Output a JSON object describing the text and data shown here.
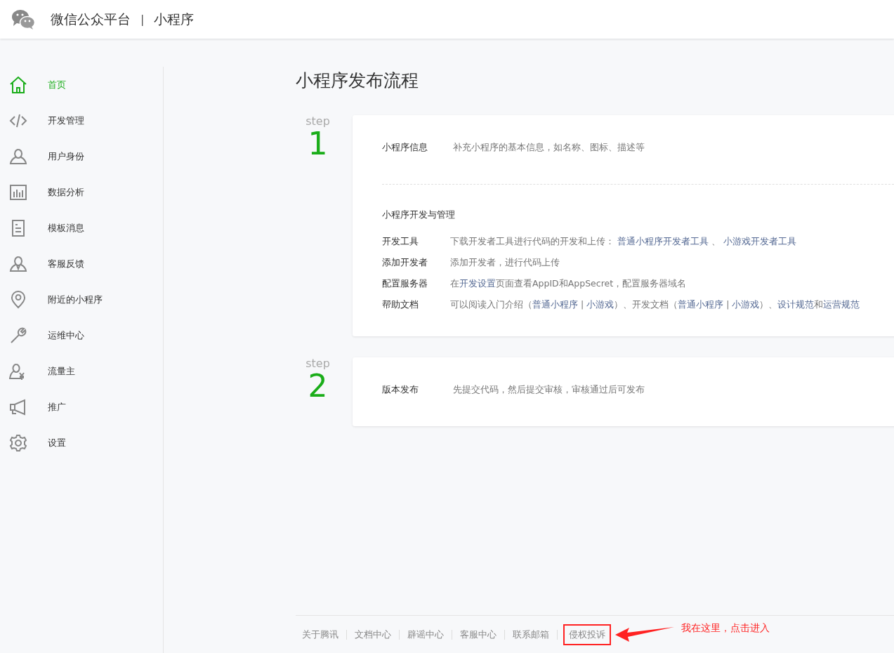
{
  "header": {
    "brand": "微信公众平台",
    "separator": "|",
    "product": "小程序"
  },
  "sidebar": {
    "items": [
      {
        "label": "首页",
        "selected": true
      },
      {
        "label": "开发管理",
        "selected": false
      },
      {
        "label": "用户身份",
        "selected": false
      },
      {
        "label": "数据分析",
        "selected": false
      },
      {
        "label": "模板消息",
        "selected": false
      },
      {
        "label": "客服反馈",
        "selected": false
      },
      {
        "label": "附近的小程序",
        "selected": false
      },
      {
        "label": "运维中心",
        "selected": false
      },
      {
        "label": "流量主",
        "selected": false
      },
      {
        "label": "推广",
        "selected": false
      },
      {
        "label": "设置",
        "selected": false
      }
    ]
  },
  "page_title": "小程序发布流程",
  "steps": [
    {
      "step_label": "step",
      "number": "1",
      "sections": [
        {
          "kind": "info",
          "label": "小程序信息",
          "description": "补充小程序的基本信息，如名称、图标、描述等"
        },
        {
          "kind": "list",
          "heading": "小程序开发与管理",
          "rows": [
            {
              "label": "开发工具",
              "segments": [
                {
                  "text": "下载开发者工具进行代码的开发和上传： ",
                  "link": false
                },
                {
                  "text": "普通小程序开发者工具",
                  "link": true
                },
                {
                  "text": " 、 ",
                  "link": false
                },
                {
                  "text": "小游戏开发者工具",
                  "link": true
                }
              ]
            },
            {
              "label": "添加开发者",
              "segments": [
                {
                  "text": "添加开发者，进行代码上传",
                  "link": false
                }
              ]
            },
            {
              "label": "配置服务器",
              "segments": [
                {
                  "text": "在",
                  "link": false
                },
                {
                  "text": "开发设置",
                  "link": true
                },
                {
                  "text": "页面查看AppID和AppSecret，配置服务器域名",
                  "link": false
                }
              ]
            },
            {
              "label": "帮助文档",
              "segments": [
                {
                  "text": "可以阅读入门介绍（",
                  "link": false
                },
                {
                  "text": "普通小程序",
                  "link": true
                },
                {
                  "text": " | ",
                  "link": false
                },
                {
                  "text": "小游戏",
                  "link": true
                },
                {
                  "text": "）、开发文档（",
                  "link": false
                },
                {
                  "text": "普通小程序",
                  "link": true
                },
                {
                  "text": " | ",
                  "link": false
                },
                {
                  "text": "小游戏",
                  "link": true
                },
                {
                  "text": "）、",
                  "link": false
                },
                {
                  "text": "设计规范",
                  "link": true
                },
                {
                  "text": "和",
                  "link": false
                },
                {
                  "text": "运营规范",
                  "link": true
                }
              ]
            }
          ]
        }
      ]
    },
    {
      "step_label": "step",
      "number": "2",
      "sections": [
        {
          "kind": "info",
          "label": "版本发布",
          "description": "先提交代码，然后提交审核，审核通过后可发布"
        }
      ]
    }
  ],
  "footer": {
    "links": [
      {
        "label": "关于腾讯",
        "highlighted": false
      },
      {
        "label": "文档中心",
        "highlighted": false
      },
      {
        "label": "辟谣中心",
        "highlighted": false
      },
      {
        "label": "客服中心",
        "highlighted": false
      },
      {
        "label": "联系邮箱",
        "highlighted": false
      },
      {
        "label": "侵权投诉",
        "highlighted": true
      }
    ],
    "annotation": "我在这里，点击进入"
  }
}
